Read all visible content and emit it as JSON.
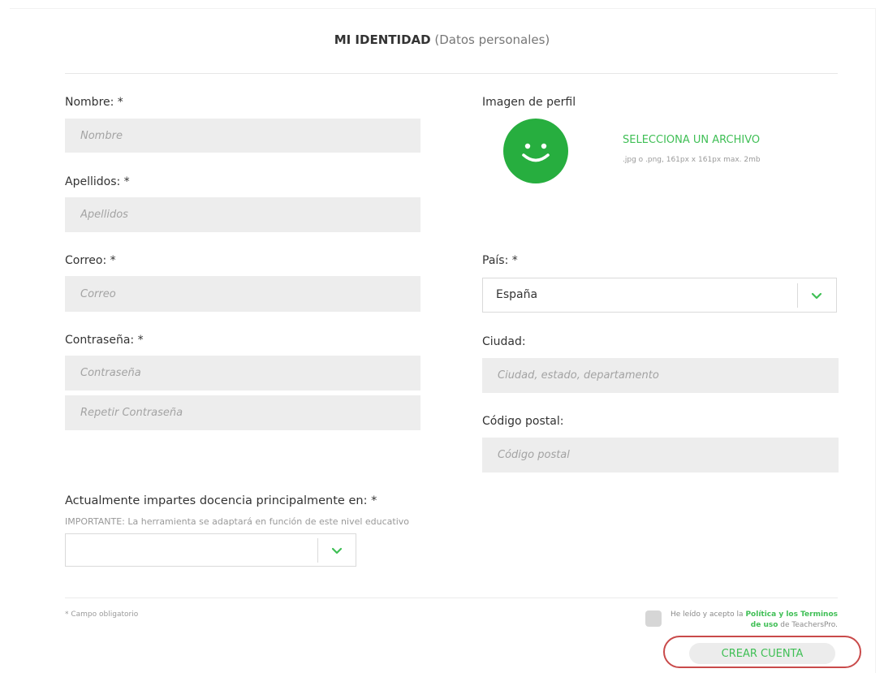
{
  "header": {
    "title_bold": "MI IDENTIDAD",
    "title_sub": "(Datos personales)"
  },
  "left": {
    "nombre": {
      "label": "Nombre: *",
      "placeholder": "Nombre"
    },
    "apellidos": {
      "label": "Apellidos: *",
      "placeholder": "Apellidos"
    },
    "correo": {
      "label": "Correo: *",
      "placeholder": "Correo"
    },
    "contrasena": {
      "label": "Contraseña: *",
      "placeholder": "Contraseña",
      "repeat_placeholder": "Repetir Contraseña"
    }
  },
  "right": {
    "imagen": {
      "label": "Imagen de perfil",
      "select_file": "SELECCIONA UN ARCHIVO",
      "hint": ".jpg o .png, 161px x 161px max. 2mb",
      "avatar_icon": "smiley-face-icon"
    },
    "pais": {
      "label": "País: *",
      "value": "España"
    },
    "ciudad": {
      "label": "Ciudad:",
      "placeholder": "Ciudad, estado, departamento"
    },
    "codigo_postal": {
      "label": "Código postal:",
      "placeholder": "Código postal"
    }
  },
  "docencia": {
    "label": "Actualmente impartes docencia principalmente en: *",
    "note": "IMPORTANTE: La herramienta se adaptará en función de este nivel educativo",
    "value": ""
  },
  "footer": {
    "required_note": "* Campo obligatorio",
    "terms_prefix": "He leído y acepto la",
    "terms_link1": "Política y los Terminos de uso",
    "terms_suffix": "de TeachersPro.",
    "create_button": "CREAR CUENTA"
  },
  "colors": {
    "accent": "#3fbf55",
    "avatar": "#27ae3f",
    "highlight": "#c94a4a",
    "field_bg": "#ededed"
  }
}
